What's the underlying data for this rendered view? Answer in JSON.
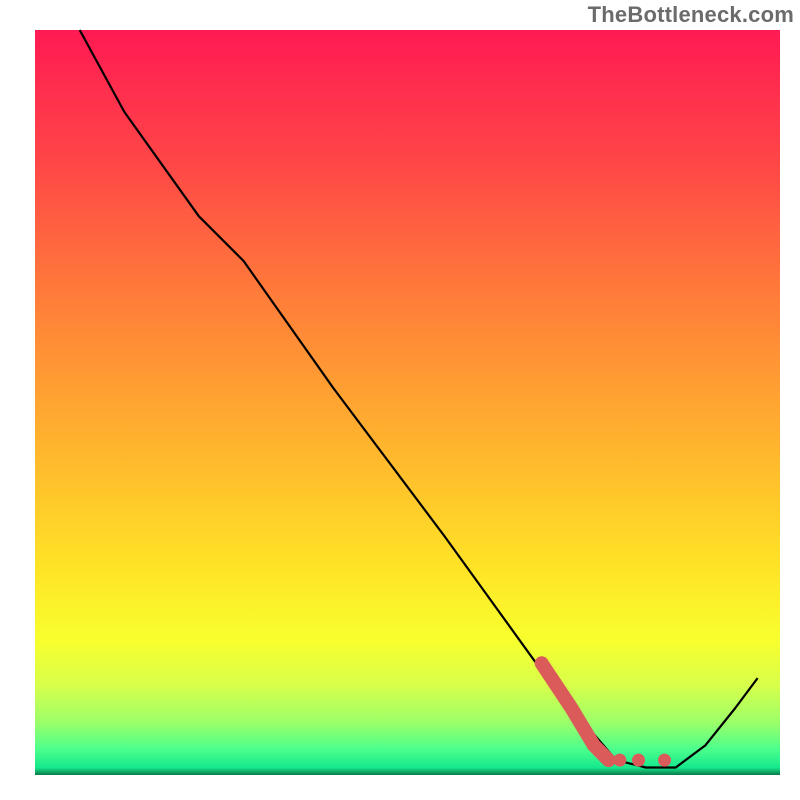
{
  "watermark": "TheBottleneck.com",
  "chart_data": {
    "type": "line",
    "title": "",
    "xlabel": "",
    "ylabel": "",
    "xlim": [
      0,
      100
    ],
    "ylim": [
      0,
      100
    ],
    "axes_visible": false,
    "grid": false,
    "gradient_background": {
      "stops": [
        {
          "offset": 0,
          "color": "#ff1a53"
        },
        {
          "offset": 0.18,
          "color": "#ff4747"
        },
        {
          "offset": 0.35,
          "color": "#ff7a3a"
        },
        {
          "offset": 0.55,
          "color": "#ffb22e"
        },
        {
          "offset": 0.72,
          "color": "#ffe326"
        },
        {
          "offset": 0.82,
          "color": "#f8ff2e"
        },
        {
          "offset": 0.88,
          "color": "#d7ff4a"
        },
        {
          "offset": 0.93,
          "color": "#9bff6a"
        },
        {
          "offset": 0.965,
          "color": "#4cff8c"
        },
        {
          "offset": 0.99,
          "color": "#15e98c"
        },
        {
          "offset": 1.0,
          "color": "#0a7a4a"
        }
      ]
    },
    "main_curve": [
      {
        "x": 6,
        "y": 100
      },
      {
        "x": 12,
        "y": 89
      },
      {
        "x": 22,
        "y": 75
      },
      {
        "x": 28,
        "y": 69
      },
      {
        "x": 40,
        "y": 52
      },
      {
        "x": 55,
        "y": 32
      },
      {
        "x": 68,
        "y": 14
      },
      {
        "x": 72,
        "y": 9
      },
      {
        "x": 78,
        "y": 2
      },
      {
        "x": 82,
        "y": 1
      },
      {
        "x": 86,
        "y": 1
      },
      {
        "x": 90,
        "y": 4
      },
      {
        "x": 94,
        "y": 9
      },
      {
        "x": 97,
        "y": 13
      }
    ],
    "highlight_segment": {
      "color": "#db5b5b",
      "points": [
        {
          "x": 68,
          "y": 15
        },
        {
          "x": 72,
          "y": 9
        },
        {
          "x": 75,
          "y": 4
        },
        {
          "x": 77,
          "y": 2
        }
      ],
      "dots": [
        {
          "x": 78.5,
          "y": 2
        },
        {
          "x": 81,
          "y": 2
        },
        {
          "x": 84.5,
          "y": 2
        }
      ]
    }
  }
}
